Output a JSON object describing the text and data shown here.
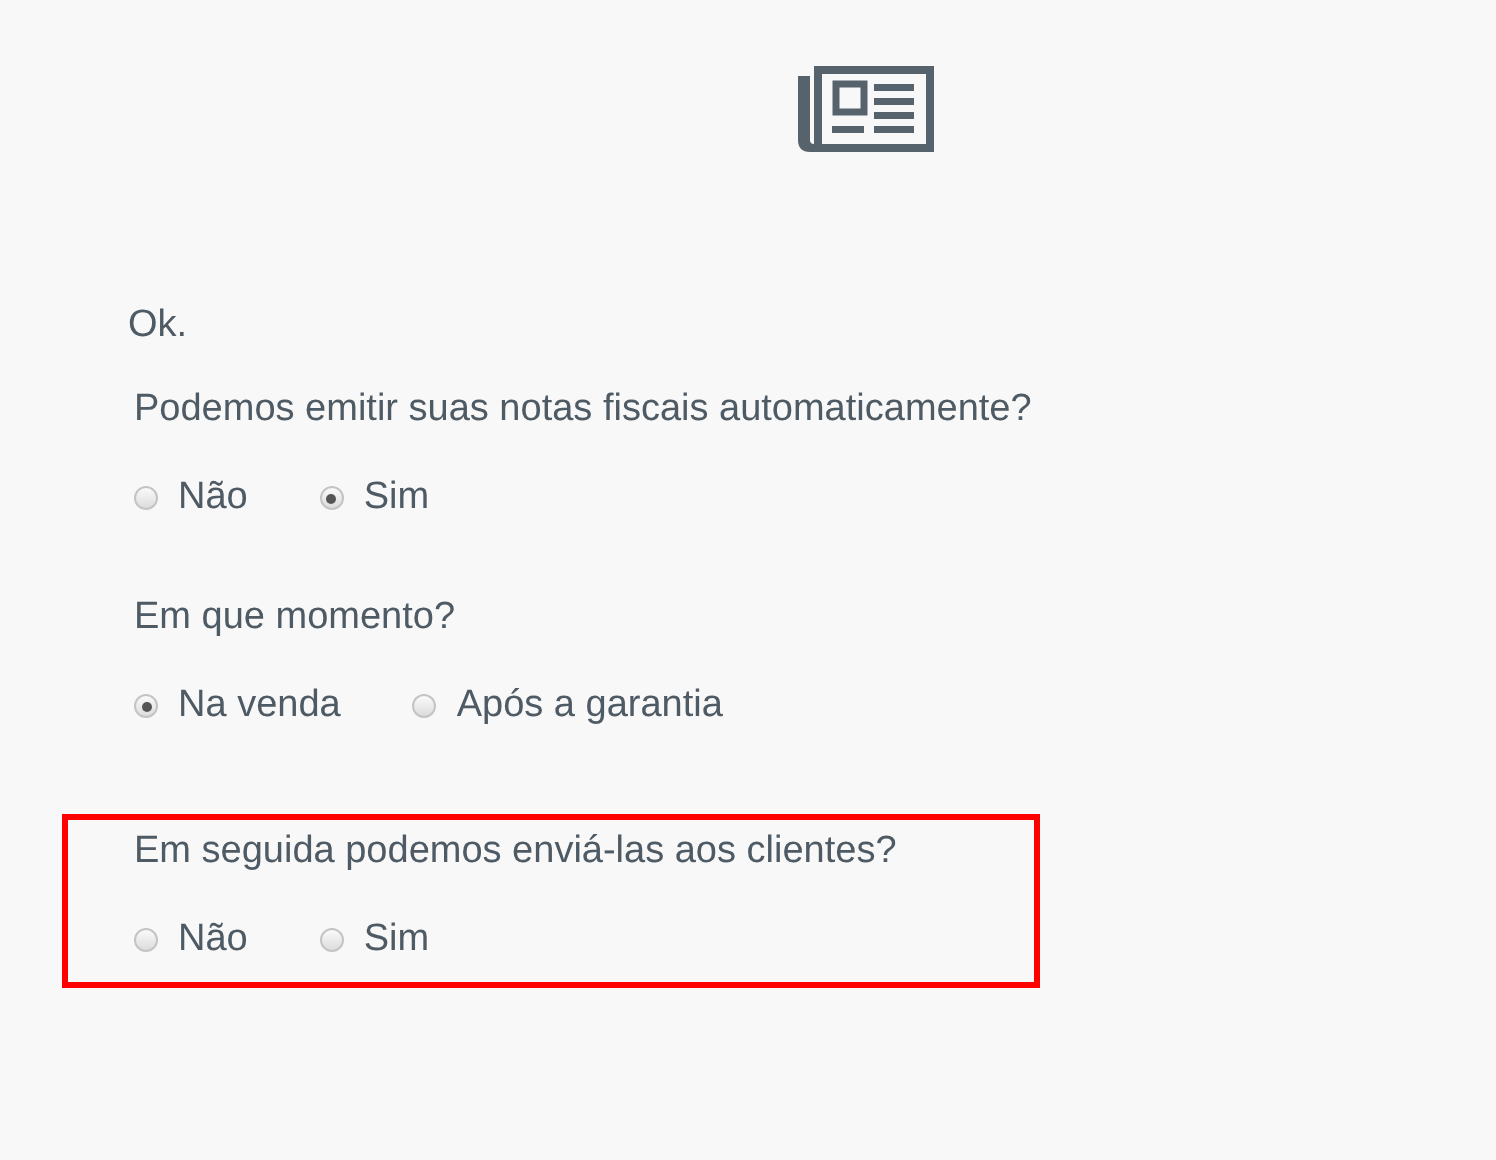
{
  "intro": "Ok.",
  "questions": [
    {
      "text": "Podemos emitir suas notas fiscais automaticamente?",
      "highlighted": false,
      "options": [
        {
          "label": "Não",
          "selected": false
        },
        {
          "label": "Sim",
          "selected": true
        }
      ]
    },
    {
      "text": "Em que momento?",
      "highlighted": false,
      "options": [
        {
          "label": "Na venda",
          "selected": true
        },
        {
          "label": "Após a garantia",
          "selected": false
        }
      ]
    },
    {
      "text": "Em seguida podemos enviá-las aos clientes?",
      "highlighted": true,
      "options": [
        {
          "label": "Não",
          "selected": false
        },
        {
          "label": "Sim",
          "selected": false
        }
      ]
    }
  ]
}
